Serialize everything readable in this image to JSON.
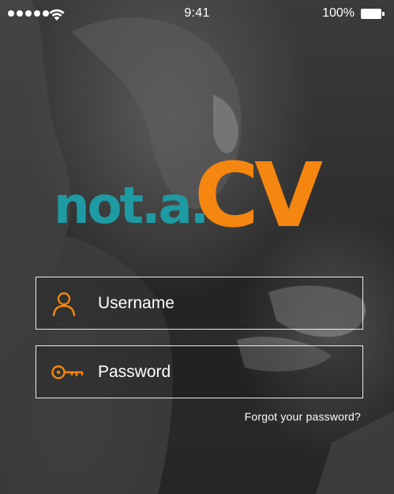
{
  "status_bar": {
    "signal_icon": "signal-dots-icon",
    "wifi_icon": "wifi-icon",
    "time": "9:41",
    "battery_percent": "100%",
    "battery_icon": "battery-full-icon"
  },
  "logo": {
    "part1": "not.a.",
    "part2": "CV",
    "color_teal": "#1e9aa3",
    "color_orange": "#f5860f"
  },
  "login_form": {
    "username_placeholder": "Username",
    "username_icon": "user-icon",
    "password_placeholder": "Password",
    "password_icon": "key-icon",
    "forgot_password": "Forgot your password?"
  },
  "accent_color": "#f5860f"
}
